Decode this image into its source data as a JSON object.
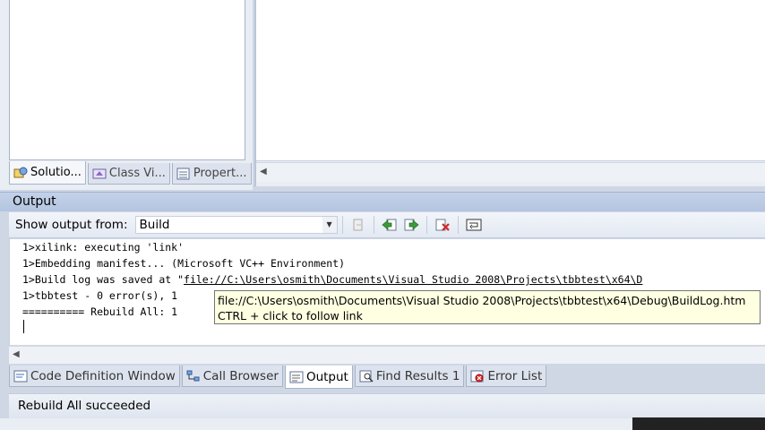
{
  "left_tabs": [
    {
      "label": "Solutio...",
      "icon": "solution-explorer-icon",
      "active": true
    },
    {
      "label": "Class Vi...",
      "icon": "class-view-icon",
      "active": false
    },
    {
      "label": "Propert...",
      "icon": "property-manager-icon",
      "active": false
    }
  ],
  "output": {
    "title": "Output",
    "show_output_label": "Show output from:",
    "source_value": "Build",
    "lines": [
      "1>xilink: executing 'link'",
      "1>Embedding manifest... (Microsoft VC++ Environment)",
      "1>Build log was saved at \"",
      "1>tbbtest - 0 error(s), 1",
      "========== Rebuild All: 1"
    ],
    "build_log_link": "file://C:\\Users\\osmith\\Documents\\Visual Studio 2008\\Projects\\tbbtest\\x64\\D",
    "tooltip": {
      "path": "file://C:\\Users\\osmith\\Documents\\Visual Studio 2008\\Projects\\tbbtest\\x64\\Debug\\BuildLog.htm",
      "hint": "CTRL + click to follow link"
    }
  },
  "bottom_tabs": [
    {
      "label": "Code Definition Window",
      "icon": "code-definition-icon",
      "active": false
    },
    {
      "label": "Call Browser",
      "icon": "call-browser-icon",
      "active": false
    },
    {
      "label": "Output",
      "icon": "output-icon",
      "active": true
    },
    {
      "label": "Find Results 1",
      "icon": "find-results-icon",
      "active": false
    },
    {
      "label": "Error List",
      "icon": "error-list-icon",
      "active": false
    }
  ],
  "status": {
    "text": "Rebuild All succeeded"
  }
}
